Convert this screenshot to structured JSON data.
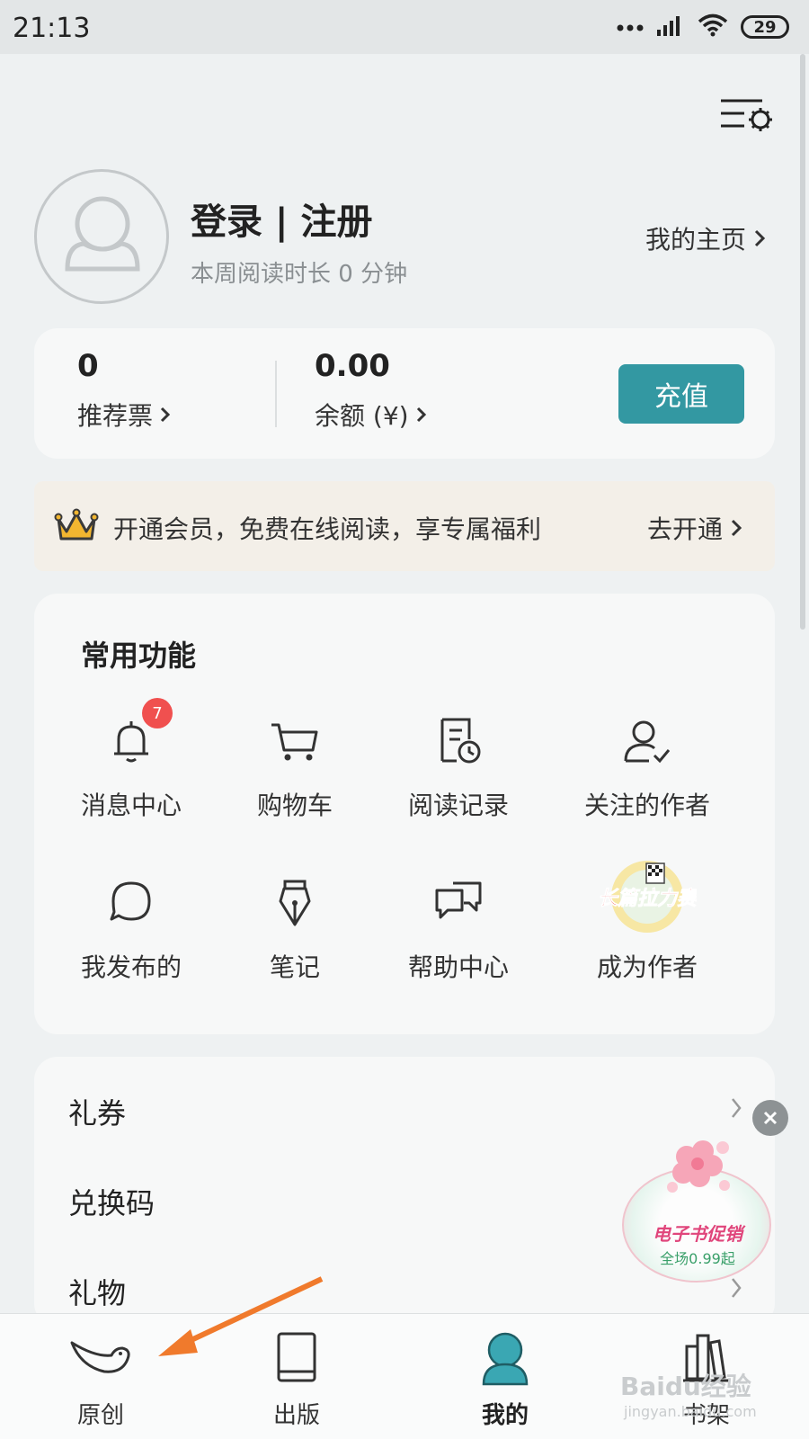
{
  "status_bar": {
    "time": "21:13",
    "battery": "29"
  },
  "profile": {
    "login_label": "登录 | 注册",
    "reading_time": "本周阅读时长 0 分钟",
    "homepage_link": "我的主页"
  },
  "wallet": {
    "tickets_value": "0",
    "tickets_label": "推荐票",
    "balance_value": "0.00",
    "balance_label": "余额 (¥)",
    "recharge_button": "充值"
  },
  "vip_banner": {
    "text": "开通会员，免费在线阅读，享专属福利",
    "action": "去开通"
  },
  "functions": {
    "title": "常用功能",
    "items": [
      {
        "label": "消息中心",
        "icon": "bell-icon",
        "badge": "7"
      },
      {
        "label": "购物车",
        "icon": "cart-icon"
      },
      {
        "label": "阅读记录",
        "icon": "reading-history-icon"
      },
      {
        "label": "关注的作者",
        "icon": "followed-author-icon"
      },
      {
        "label": "我发布的",
        "icon": "chat-bubble-icon"
      },
      {
        "label": "笔记",
        "icon": "pen-nib-icon"
      },
      {
        "label": "帮助中心",
        "icon": "help-chat-icon"
      },
      {
        "label": "成为作者",
        "icon": "writing-contest-icon",
        "icon_text": "长篇拉力赛"
      }
    ]
  },
  "list": {
    "items": [
      {
        "label": "礼券"
      },
      {
        "label": "兑换码"
      },
      {
        "label": "礼物"
      }
    ]
  },
  "promo": {
    "title": "电子书促销",
    "subtitle": "全场0.99起"
  },
  "tab_bar": {
    "tabs": [
      {
        "label": "原创",
        "icon": "bird-icon"
      },
      {
        "label": "出版",
        "icon": "book-icon"
      },
      {
        "label": "我的",
        "icon": "user-icon",
        "active": true
      },
      {
        "label": "书架",
        "icon": "bookshelf-icon"
      }
    ]
  },
  "watermark": {
    "brand": "Baidu经验",
    "url": "jingyan.baidu.com"
  },
  "colors": {
    "accent": "#3398a2",
    "badge": "#f0504f",
    "vip_bg": "#f3efe8",
    "crown": "#f2b630"
  }
}
